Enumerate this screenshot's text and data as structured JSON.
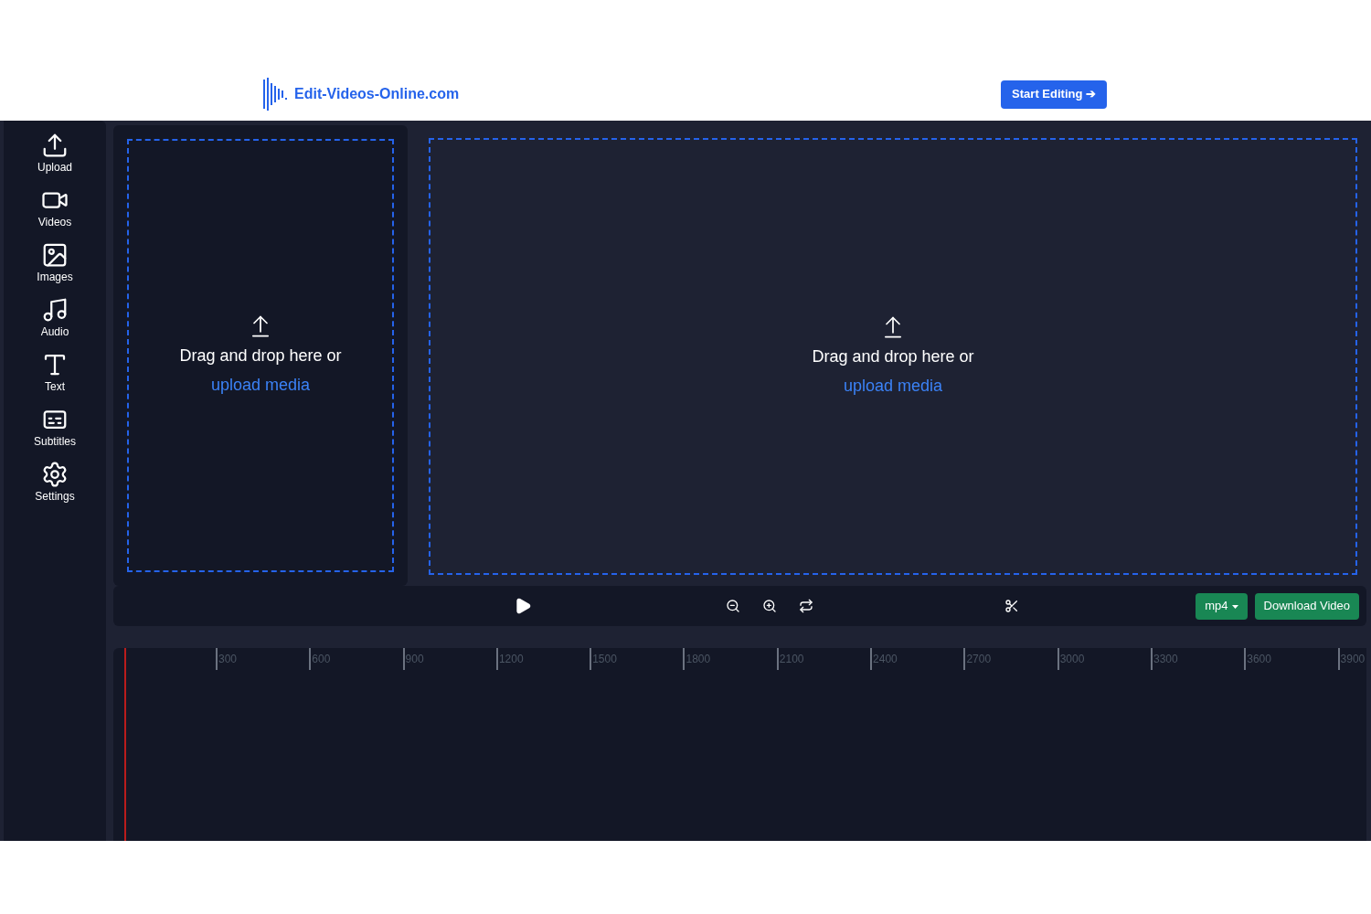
{
  "header": {
    "logo_text": "Edit-Videos-Online.com",
    "cta": "Start Editing ➔"
  },
  "sidebar": {
    "items": [
      {
        "kind": "upload",
        "label": "Upload"
      },
      {
        "kind": "videos",
        "label": "Videos"
      },
      {
        "kind": "images",
        "label": "Images"
      },
      {
        "kind": "audio",
        "label": "Audio"
      },
      {
        "kind": "text",
        "label": "Text"
      },
      {
        "kind": "subtitles",
        "label": "Subtitles"
      },
      {
        "kind": "settings",
        "label": "Settings"
      }
    ]
  },
  "media_panel": {
    "prompt": "Drag and drop here or",
    "link": "upload media"
  },
  "preview": {
    "prompt": "Drag and drop here or",
    "link": "upload media"
  },
  "toolbar": {
    "format": "mp4",
    "download": "Download Video"
  },
  "timeline": {
    "ticks": [
      "300",
      "600",
      "900",
      "1200",
      "1500",
      "1800",
      "2100",
      "2400",
      "2700",
      "3000",
      "3300",
      "3600",
      "3900"
    ]
  }
}
